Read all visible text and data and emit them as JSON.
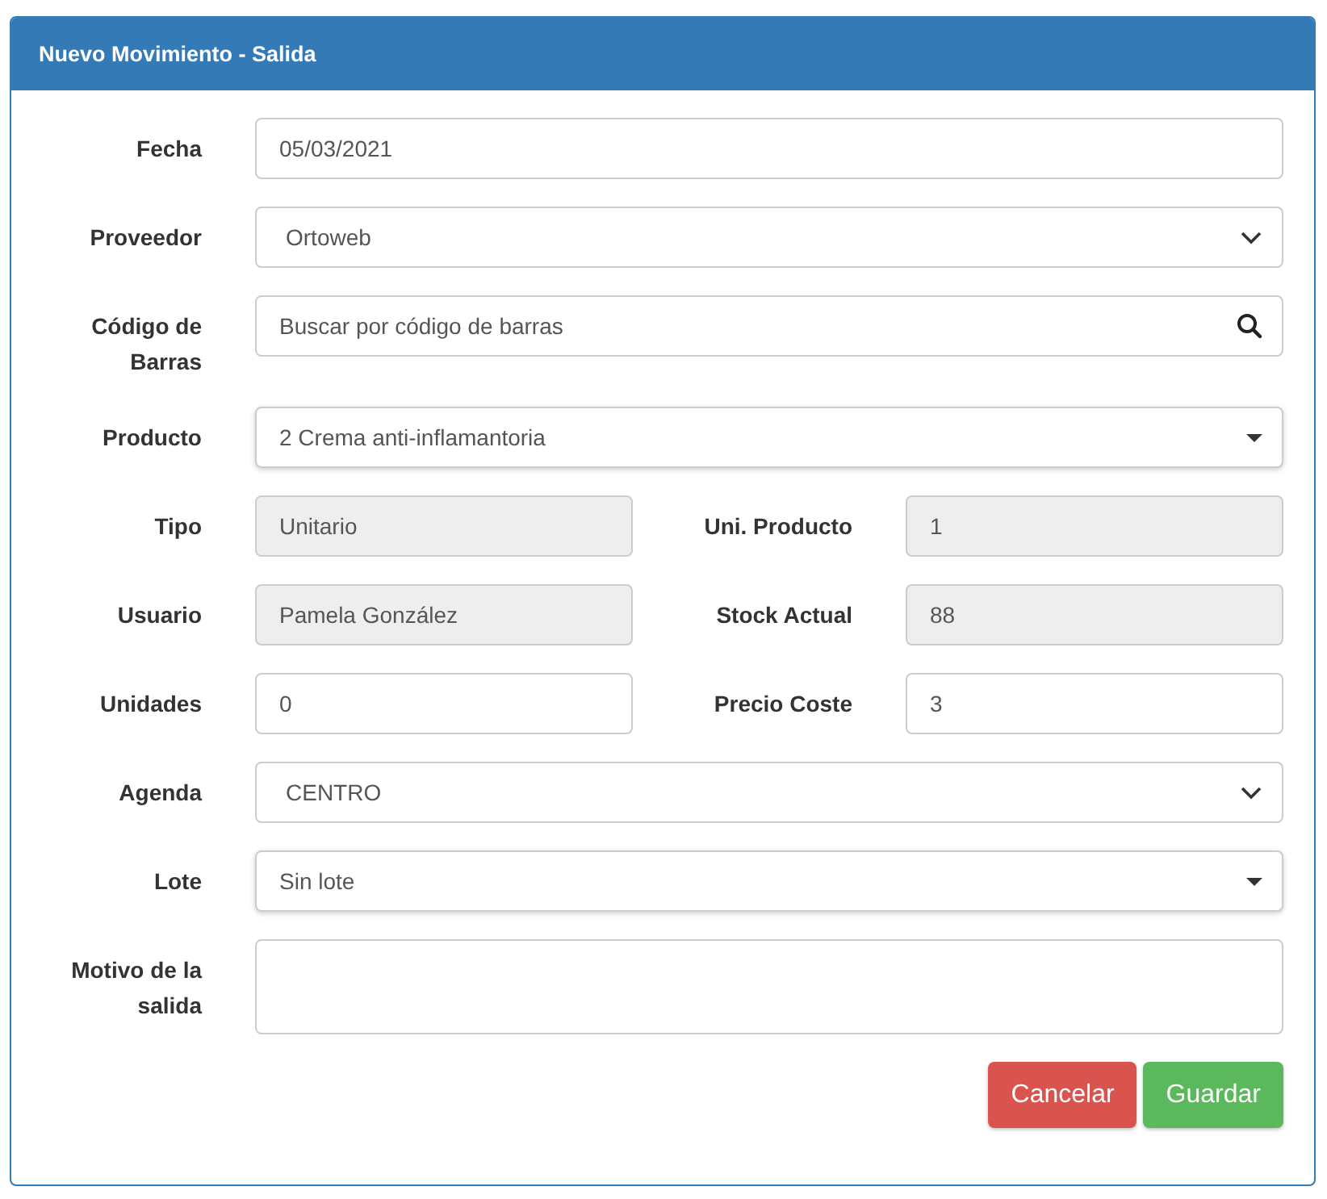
{
  "panel": {
    "title": "Nuevo Movimiento - Salida"
  },
  "rows": [
    {
      "fields": [
        {
          "label": "Fecha",
          "kind": "text",
          "value": "05/03/2021",
          "disabled": false
        }
      ]
    },
    {
      "fields": [
        {
          "label": "Proveedor",
          "kind": "select",
          "value": "Ortoweb",
          "disabled": false
        }
      ]
    },
    {
      "fields": [
        {
          "label": "Código de Barras",
          "kind": "search",
          "placeholder": "Buscar por código de barras",
          "disabled": false
        }
      ]
    },
    {
      "fields": [
        {
          "label": "Producto",
          "kind": "combo",
          "value": "2 Crema anti-inflamantoria",
          "disabled": false
        }
      ]
    },
    {
      "fields": [
        {
          "label": "Tipo",
          "kind": "text",
          "value": "Unitario",
          "disabled": true
        },
        {
          "label": "Uni. Producto",
          "kind": "text",
          "value": "1",
          "disabled": true
        }
      ]
    },
    {
      "fields": [
        {
          "label": "Usuario",
          "kind": "text",
          "value": "Pamela González",
          "disabled": true
        },
        {
          "label": "Stock Actual",
          "kind": "text",
          "value": "88",
          "disabled": true
        }
      ]
    },
    {
      "fields": [
        {
          "label": "Unidades",
          "kind": "text",
          "value": "0",
          "disabled": false
        },
        {
          "label": "Precio Coste",
          "kind": "text",
          "value": "3",
          "disabled": false
        }
      ]
    },
    {
      "fields": [
        {
          "label": "Agenda",
          "kind": "select",
          "value": "CENTRO",
          "disabled": false
        }
      ]
    },
    {
      "fields": [
        {
          "label": "Lote",
          "kind": "combo",
          "value": "Sin lote",
          "disabled": false
        }
      ]
    },
    {
      "fields": [
        {
          "label": "Motivo de la salida",
          "kind": "textarea",
          "disabled": false
        }
      ]
    }
  ],
  "buttons": [
    {
      "label": "Cancelar",
      "kind": "danger"
    },
    {
      "label": "Guardar",
      "kind": "success"
    }
  ]
}
